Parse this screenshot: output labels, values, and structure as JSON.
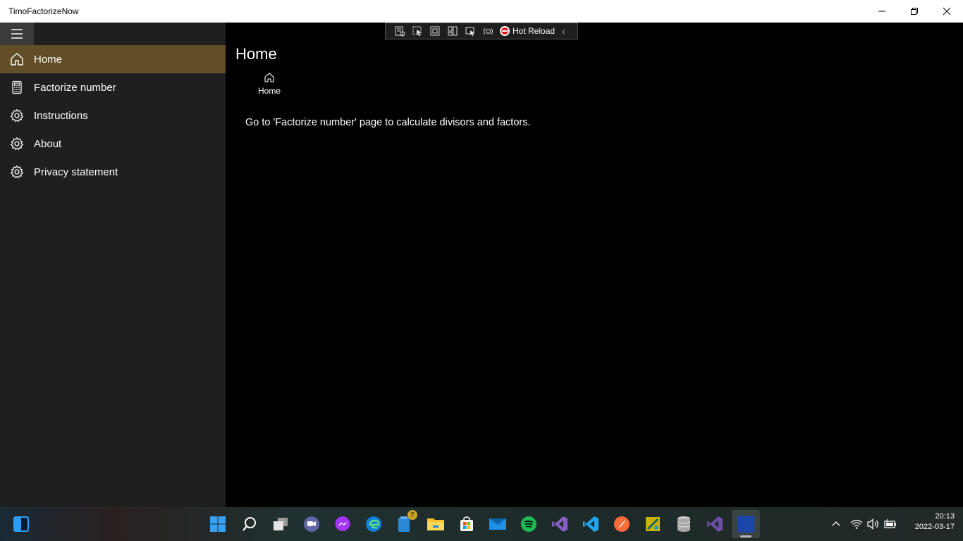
{
  "window": {
    "title": "TimoFactorizeNow"
  },
  "nav": {
    "items": [
      {
        "label": "Home",
        "icon": "home-icon",
        "selected": true
      },
      {
        "label": "Factorize number",
        "icon": "calculator-icon",
        "selected": false
      },
      {
        "label": "Instructions",
        "icon": "gear-icon",
        "selected": false
      },
      {
        "label": "About",
        "icon": "gear-icon",
        "selected": false
      },
      {
        "label": "Privacy statement",
        "icon": "gear-icon",
        "selected": false
      }
    ]
  },
  "main": {
    "title": "Home",
    "breadcrumb": {
      "label": "Home",
      "icon": "home-icon"
    },
    "description": "Go to 'Factorize number' page to calculate divisors and factors."
  },
  "debug_toolbar": {
    "hot_reload_label": "Hot Reload"
  },
  "taskbar": {
    "apps": [
      {
        "name": "widgets-icon",
        "color": "#1e88e5"
      },
      {
        "name": "start-icon",
        "color": "#3aa0f3"
      },
      {
        "name": "search-icon",
        "color": "#ffffff"
      },
      {
        "name": "task-view-icon",
        "color": "#cfcfcf"
      },
      {
        "name": "teams-chat-icon",
        "color": "#6264a7"
      },
      {
        "name": "messenger-icon",
        "color": "#a334fa"
      },
      {
        "name": "edge-icon",
        "color": "#0f7fd8"
      },
      {
        "name": "todo-icon",
        "color": "#2b88d8",
        "badge": "7"
      },
      {
        "name": "file-explorer-icon",
        "color": "#f7c325"
      },
      {
        "name": "store-icon",
        "color": "#f25022"
      },
      {
        "name": "mail-icon",
        "color": "#0a64ad"
      },
      {
        "name": "spotify-icon",
        "color": "#1db954"
      },
      {
        "name": "visual-studio-icon",
        "color": "#865fc5"
      },
      {
        "name": "vscode-icon",
        "color": "#22a6f2"
      },
      {
        "name": "postman-icon",
        "color": "#ff6c37"
      },
      {
        "name": "sketch-tool-icon",
        "color": "#c8b400"
      },
      {
        "name": "database-icon",
        "color": "#b0b0b0"
      },
      {
        "name": "visual-studio-preview-icon",
        "color": "#865fc5"
      },
      {
        "name": "timofactorizenow-app-icon",
        "color": "#1a46a8"
      }
    ],
    "clock": {
      "time": "20:13",
      "date": "2022-03-17"
    }
  },
  "colors": {
    "nav_selected": "#614d26",
    "nav_bg": "#1f1f1f",
    "content_bg": "#000000"
  }
}
